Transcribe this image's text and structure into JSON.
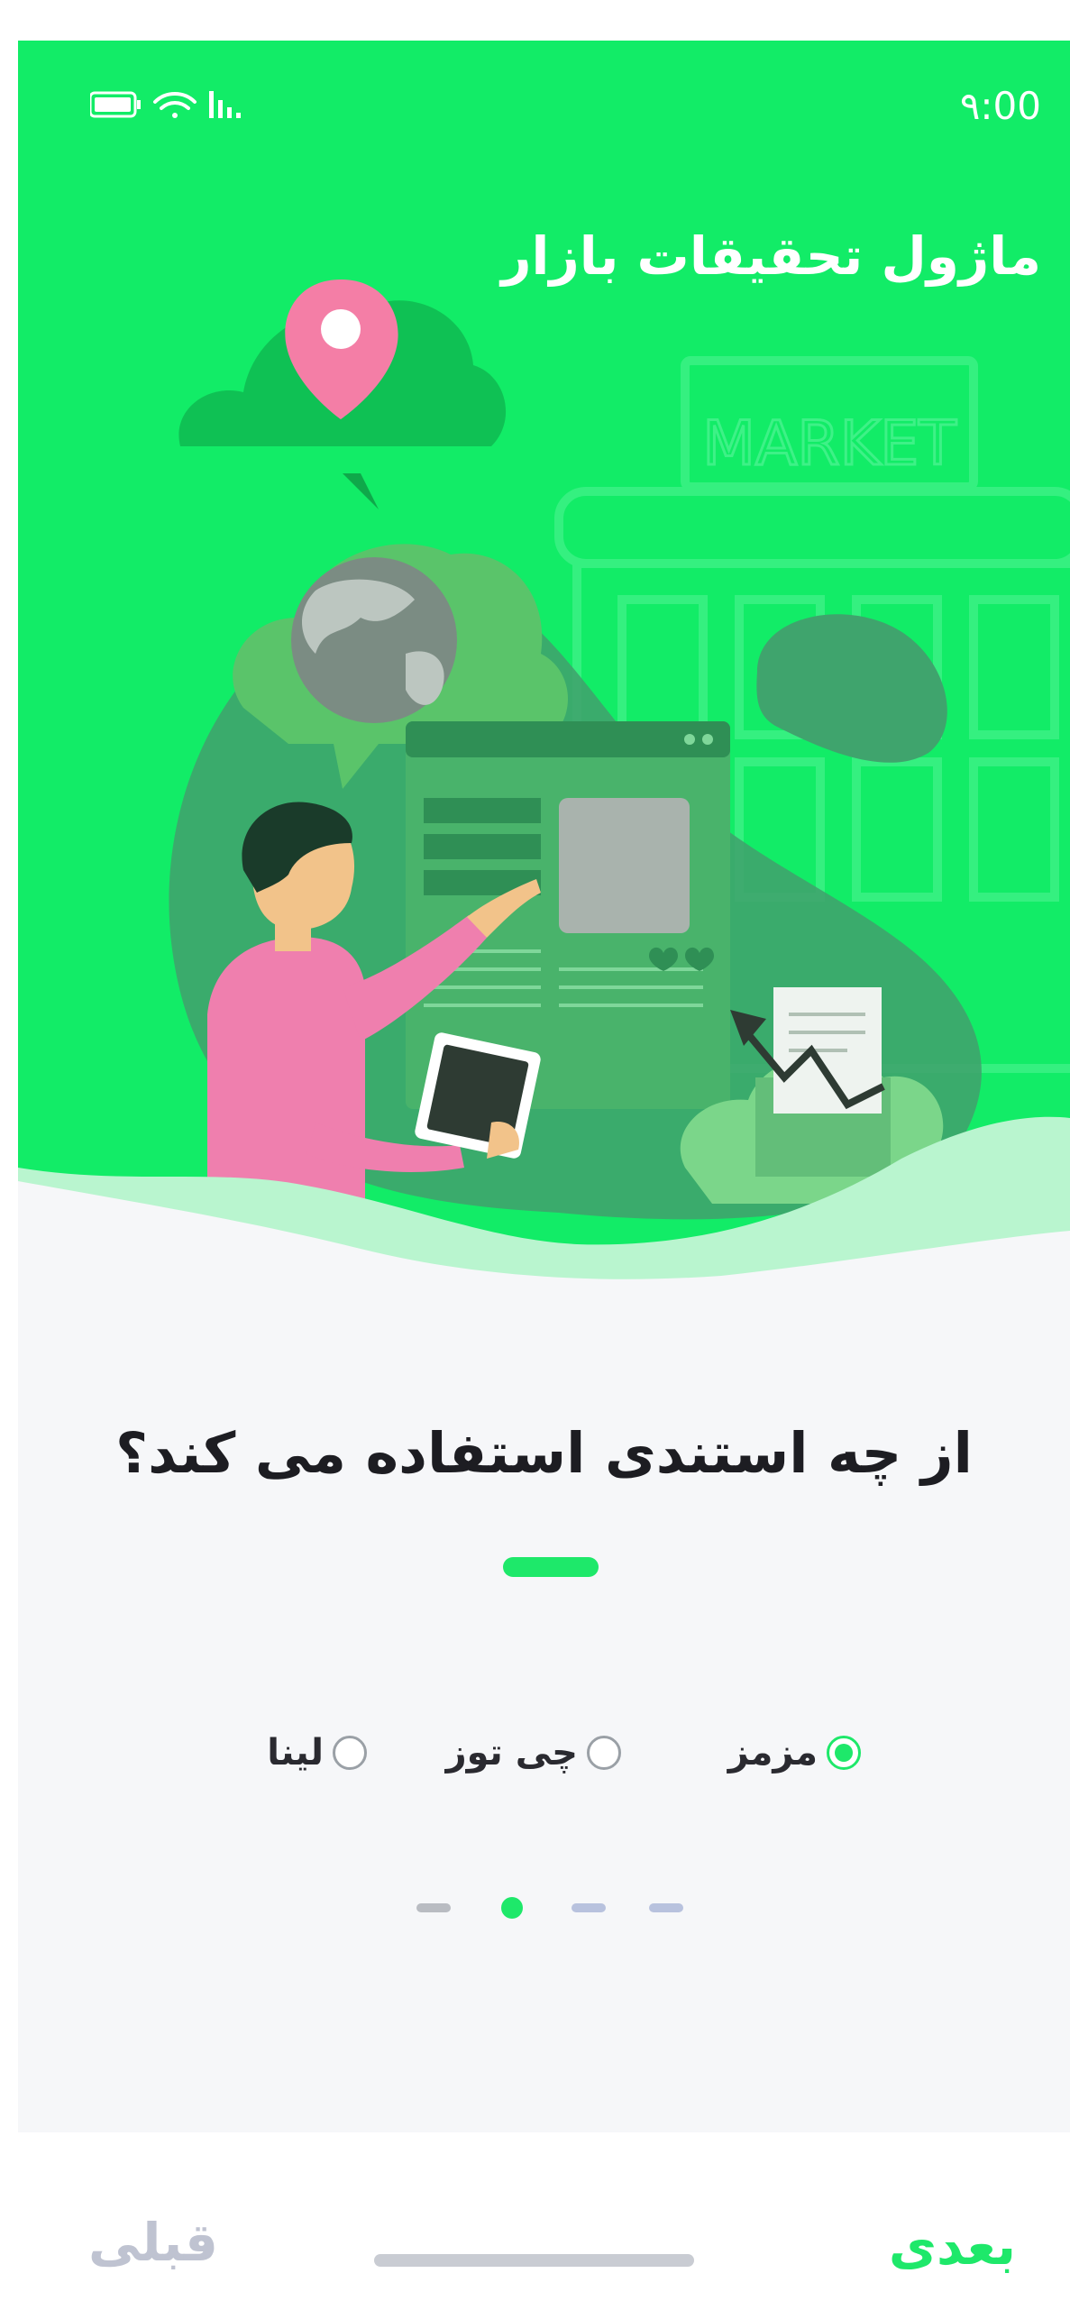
{
  "status_bar": {
    "time": "۹:00"
  },
  "header": {
    "module_title": "ماژول تحقیقات بازار"
  },
  "illustration": {
    "sign_text": "MARKET"
  },
  "question": {
    "text": "از چه استندی استفاده می کند؟"
  },
  "options": [
    {
      "label": "مزمز",
      "checked": true
    },
    {
      "label": "چی توز",
      "checked": false
    },
    {
      "label": "لینا",
      "checked": false
    }
  ],
  "pager": {
    "total": 4,
    "current": 2
  },
  "footer": {
    "next_label": "بعدی",
    "prev_label": "قبلی"
  },
  "colors": {
    "accent": "#1ee86a",
    "hero_green": "#12ec67",
    "pin_pink": "#f47ea6",
    "shirt_pink": "#ef7fae",
    "muted": "#bfc3d1"
  }
}
